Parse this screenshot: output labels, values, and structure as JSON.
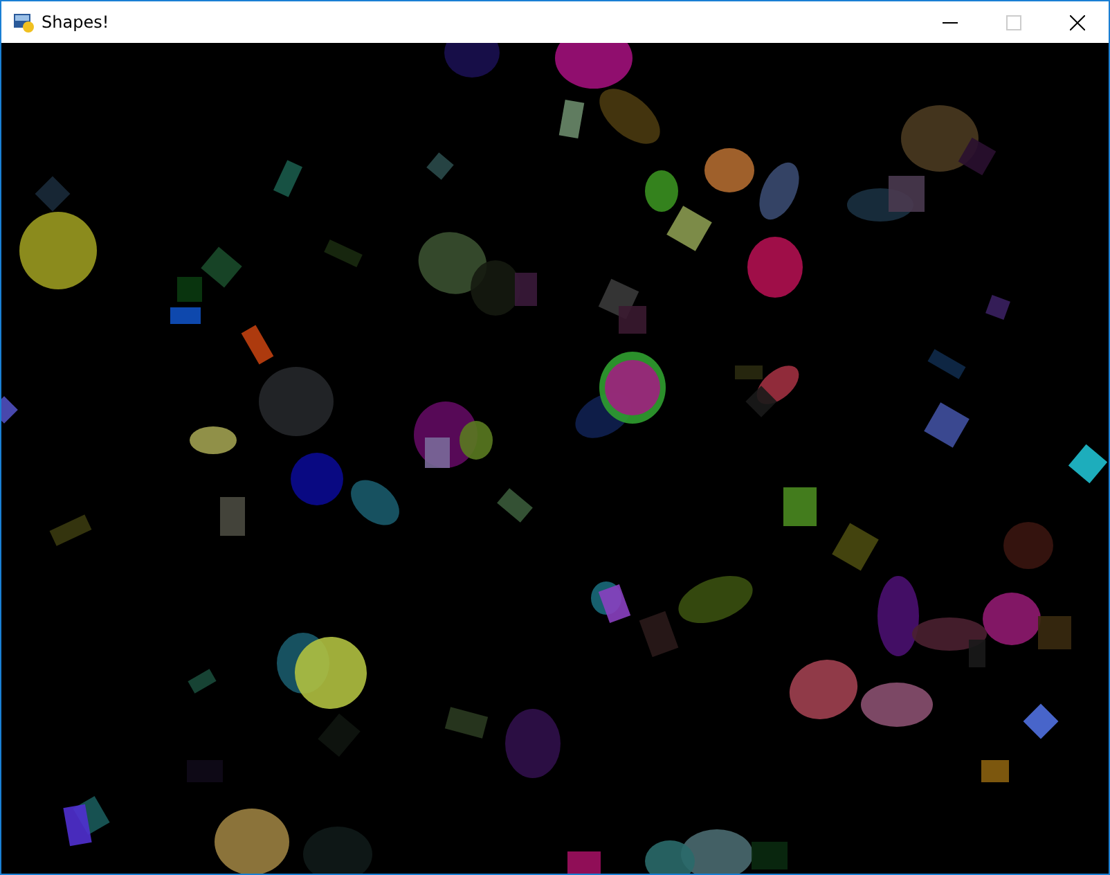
{
  "window": {
    "title": "Shapes!",
    "controls": [
      {
        "kind": "minimize",
        "disabled": false
      },
      {
        "kind": "maximize",
        "disabled": true
      },
      {
        "kind": "close",
        "disabled": false
      }
    ]
  }
}
